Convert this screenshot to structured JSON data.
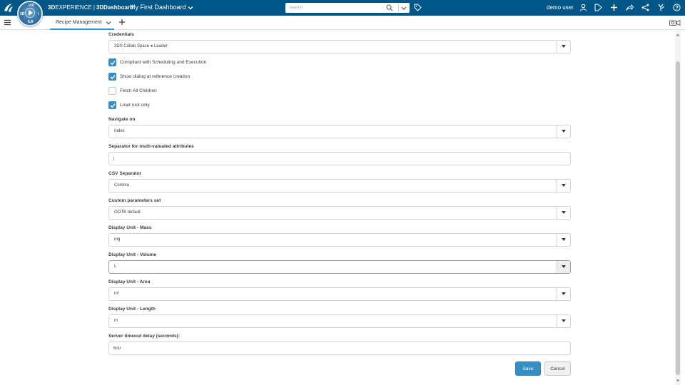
{
  "topbar": {
    "brand_prefix": "3D",
    "brand_name": "EXPERIENCE",
    "brand_separator": "|",
    "brand_app": "3DDashboard",
    "dashboard_title": "My First Dashboard",
    "search_placeholder": "Search",
    "user_name": "demo user",
    "compass_labels": {
      "top": "V.R",
      "left": "3D",
      "right": "i",
      "bottom": "6,R"
    },
    "icons": [
      "user-icon",
      "share-tag-icon",
      "add-icon",
      "forward-icon",
      "network-icon",
      "apps-icon",
      "help-icon"
    ]
  },
  "tabbar": {
    "active_tab": "Recipe Management"
  },
  "form": {
    "credentials": {
      "label": "Credentials",
      "value": "3DS Collab Space ● Leader"
    },
    "checkboxes": [
      {
        "label": "Compliant with Scheduling and Execution",
        "checked": true
      },
      {
        "label": "Show dialog at reference creation",
        "checked": true
      },
      {
        "label": "Fetch All Children",
        "checked": false
      },
      {
        "label": "Load root only",
        "checked": true
      }
    ],
    "navigate_on": {
      "label": "Navigate on",
      "value": "Index"
    },
    "separator_multi": {
      "label": "Separator for multi-valuated attributes",
      "value": "|"
    },
    "csv_separator": {
      "label": "CSV Separator",
      "value": "Comma"
    },
    "custom_params": {
      "label": "Custom parameters set",
      "value": "OOTB default"
    },
    "unit_mass": {
      "label": "Display Unit - Mass",
      "value": "mg"
    },
    "unit_volume": {
      "label": "Display Unit - Volume",
      "value": "L"
    },
    "unit_area": {
      "label": "Display Unit - Area",
      "value": "m²"
    },
    "unit_length": {
      "label": "Display Unit - Length",
      "value": "m"
    },
    "timeout": {
      "label": "Server timeout delay (seconds):",
      "value": "600"
    },
    "save_label": "Save",
    "cancel_label": "Cancel"
  },
  "colors": {
    "topbar": "#005686",
    "accent": "#368ec4",
    "border": "#d1d4d4"
  }
}
